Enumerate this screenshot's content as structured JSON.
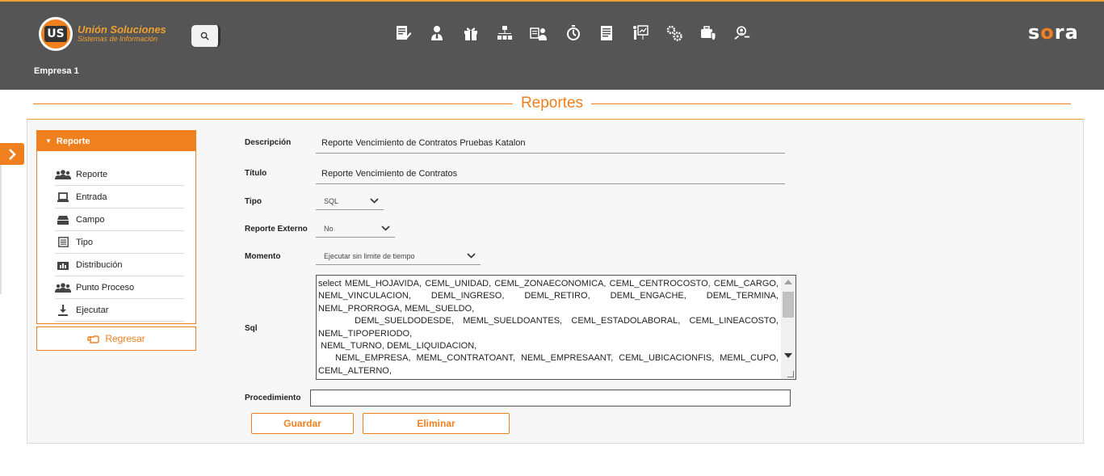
{
  "header": {
    "logo_short": "US",
    "logo_title": "Unión Soluciones",
    "logo_subtitle": "Sistemas de Información",
    "brand_prefix": "s",
    "brand_o": "o",
    "brand_suffix": "ra",
    "company": "Empresa 1"
  },
  "toolbar_icons": [
    "report-edit-icon",
    "user-tie-icon",
    "gift-icon",
    "org-chart-icon",
    "employee-badge-icon",
    "stopwatch-icon",
    "document-list-icon",
    "presentation-icon",
    "gears-icon",
    "shield-briefcase-icon",
    "people-search-icon"
  ],
  "page": {
    "title": "Reportes"
  },
  "menu": {
    "header": "Reporte",
    "items": [
      {
        "label": "Reporte",
        "icon": "users-icon"
      },
      {
        "label": "Entrada",
        "icon": "laptop-icon"
      },
      {
        "label": "Campo",
        "icon": "tray-icon"
      },
      {
        "label": "Tipo",
        "icon": "list-icon"
      },
      {
        "label": "Distribución",
        "icon": "distribution-icon"
      },
      {
        "label": "Punto Proceso",
        "icon": "users-icon"
      },
      {
        "label": "Ejecutar",
        "icon": "download-icon"
      }
    ],
    "back_label": "Regresar"
  },
  "form": {
    "descripcion_label": "Descripción",
    "descripcion_value": "Reporte Vencimiento de Contratos Pruebas Katalon",
    "titulo_label": "Título",
    "titulo_value": "Reporte Vencimiento de Contratos",
    "tipo_label": "Tipo",
    "tipo_value": "SQL",
    "externo_label": "Reporte Externo",
    "externo_value": "No",
    "momento_label": "Momento",
    "momento_value": "Ejecutar sin limite de tiempo",
    "sql_label": "Sql",
    "sql_lines": [
      "select MEML_HOJAVIDA, CEML_UNIDAD, CEML_ZONAECONOMICA, CEML_CENTROCOSTO, CEML_CARGO,",
      "NEML_VINCULACION, DEML_INGRESO, DEML_RETIRO, DEML_ENGACHE, DEML_TERMINA,",
      "NEML_PRORROGA, MEML_SUELDO,",
      "    DEML_SUELDODESDE, MEML_SUELDOANTES, CEML_ESTADOLABORAL, CEML_LINEACOSTO,",
      "NEML_TIPOPERIODO,",
      " NEML_TURNO, DEML_LIQUIDACION,",
      "   NEML_EMPRESA, MEML_CONTRATOANT, NEML_EMPRESAANT, CEML_UBICACIONFIS, MEML_CUPO,",
      "CEML_ALTERNO,"
    ],
    "procedimiento_label": "Procedimiento",
    "procedimiento_value": "",
    "save_label": "Guardar",
    "delete_label": "Eliminar"
  }
}
